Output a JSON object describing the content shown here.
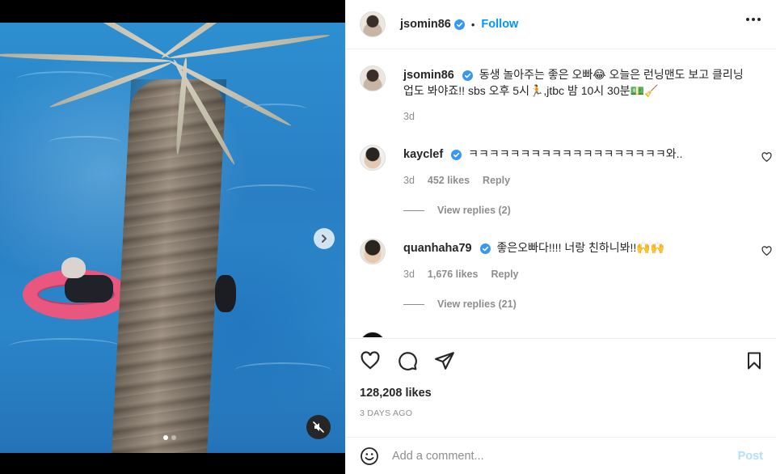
{
  "post": {
    "author": "jsomin86",
    "follow_label": "Follow",
    "separator": "•",
    "caption_author": "jsomin86",
    "caption": "동생 놀아주는 좋은 오빠😂 오늘은 런닝맨도 보고 클리닝업도 봐야죠!! sbs 오후 5시🏃,jtbc 밤 10시 30분💵🧹",
    "caption_time": "3d"
  },
  "media": {
    "carousel_total": 2,
    "carousel_index": 1
  },
  "comments": [
    {
      "username": "kayclef",
      "text": "ㅋㅋㅋㅋㅋㅋㅋㅋㅋㅋㅋㅋㅋㅋㅋㅋㅋㅋㅋ와..",
      "time": "3d",
      "likes": "452 likes",
      "reply_label": "Reply",
      "view_replies": "View replies (2)"
    },
    {
      "username": "quanhaha79",
      "text": "좋은오빠다!!!! 너랑 친하니봐!!🙌🙌",
      "time": "3d",
      "likes": "1,676 likes",
      "reply_label": "Reply",
      "view_replies": "View replies (21)"
    }
  ],
  "actions": {
    "likes": "128,208 likes",
    "date": "3 DAYS AGO"
  },
  "add_comment": {
    "placeholder": "Add a comment...",
    "post_label": "Post"
  },
  "colors": {
    "accent": "#0095f6",
    "verified": "#3897f0",
    "muted": "#8e8e8e",
    "post_disabled": "#b2dffc"
  }
}
